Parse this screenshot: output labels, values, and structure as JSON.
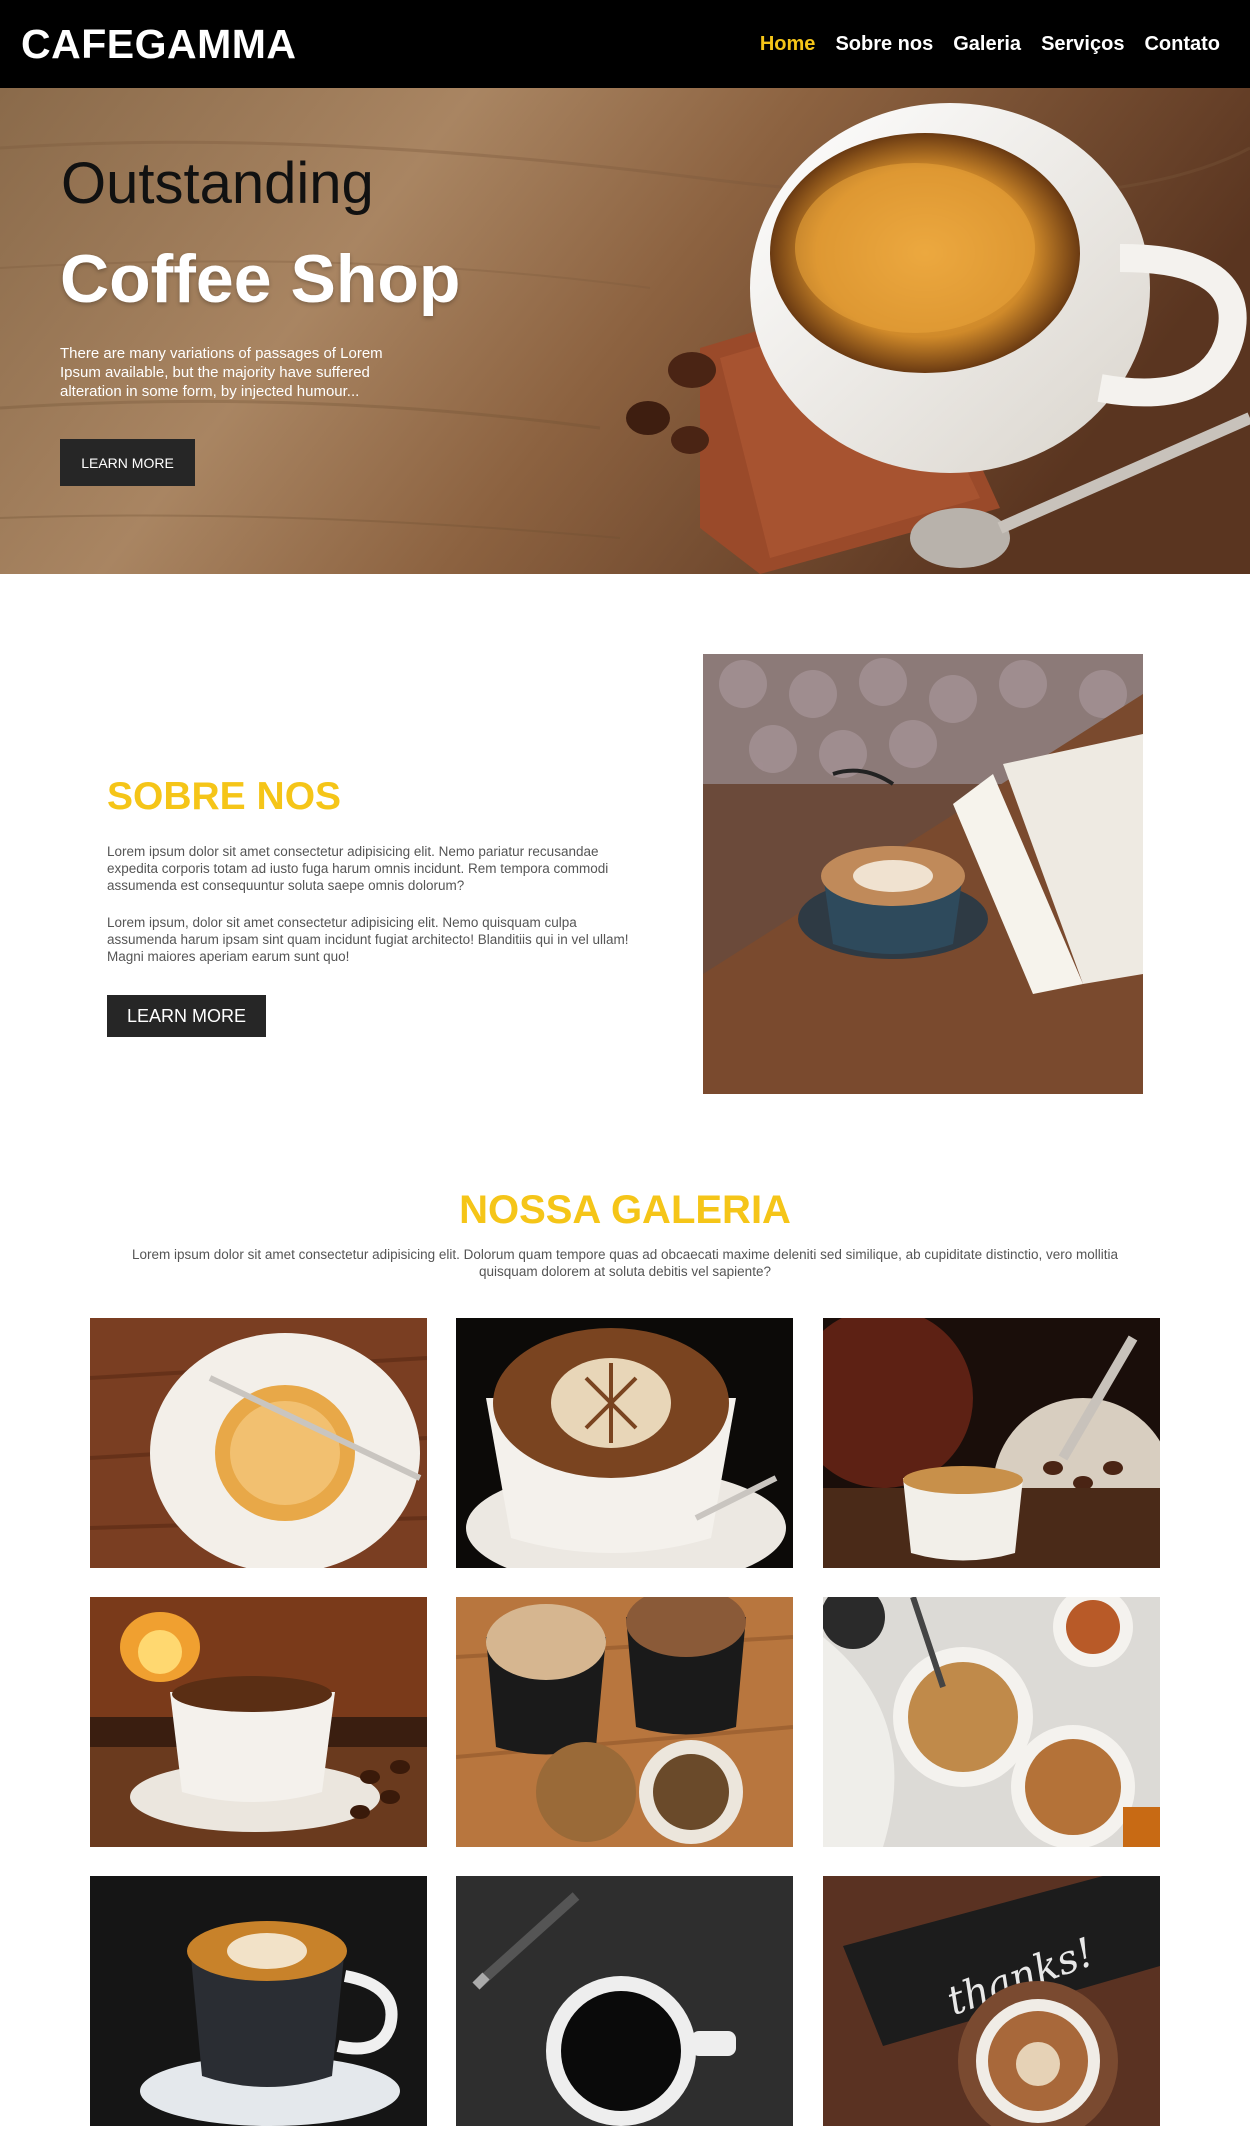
{
  "navbar": {
    "brand": "CAFEGAMMA",
    "items": [
      {
        "label": "Home",
        "active": true
      },
      {
        "label": "Sobre nos",
        "active": false
      },
      {
        "label": "Galeria",
        "active": false
      },
      {
        "label": "Serviços",
        "active": false
      },
      {
        "label": "Contato",
        "active": false
      }
    ]
  },
  "hero": {
    "title_line1": "Outstanding",
    "title_line2": "Coffee Shop",
    "text": "There are many variations of passages of Lorem Ipsum available, but the majority have suffered alteration in some form, by injected humour...",
    "button": "LEARN MORE"
  },
  "sobre": {
    "title": "SOBRE NOS",
    "paragraph1": "Lorem ipsum dolor sit amet consectetur adipisicing elit. Nemo pariatur recusandae expedita corporis totam ad iusto fuga harum omnis incidunt. Rem tempora commodi assumenda est consequuntur soluta saepe omnis dolorum?",
    "paragraph2": "Lorem ipsum, dolor sit amet consectetur adipisicing elit. Nemo quisquam culpa assumenda harum ipsam sint quam incidunt fugiat architecto! Blanditiis qui in vel ullam! Magni maiores aperiam earum sunt quo!",
    "button": "LEARN MORE"
  },
  "galeria": {
    "title": "NOSSA GALERIA",
    "subtitle": "Lorem ipsum dolor sit amet consectetur adipisicing elit. Dolorum quam tempore quas ad obcaecati maxime deleniti sed similique, ab cupiditate distinctio, vero mollitia quisquam dolorem at soluta debitis vel sapiente?",
    "thanks_note": "thanks!"
  },
  "colors": {
    "accent": "#f5c518",
    "navbar_bg": "#000000",
    "button_bg": "#262626"
  }
}
